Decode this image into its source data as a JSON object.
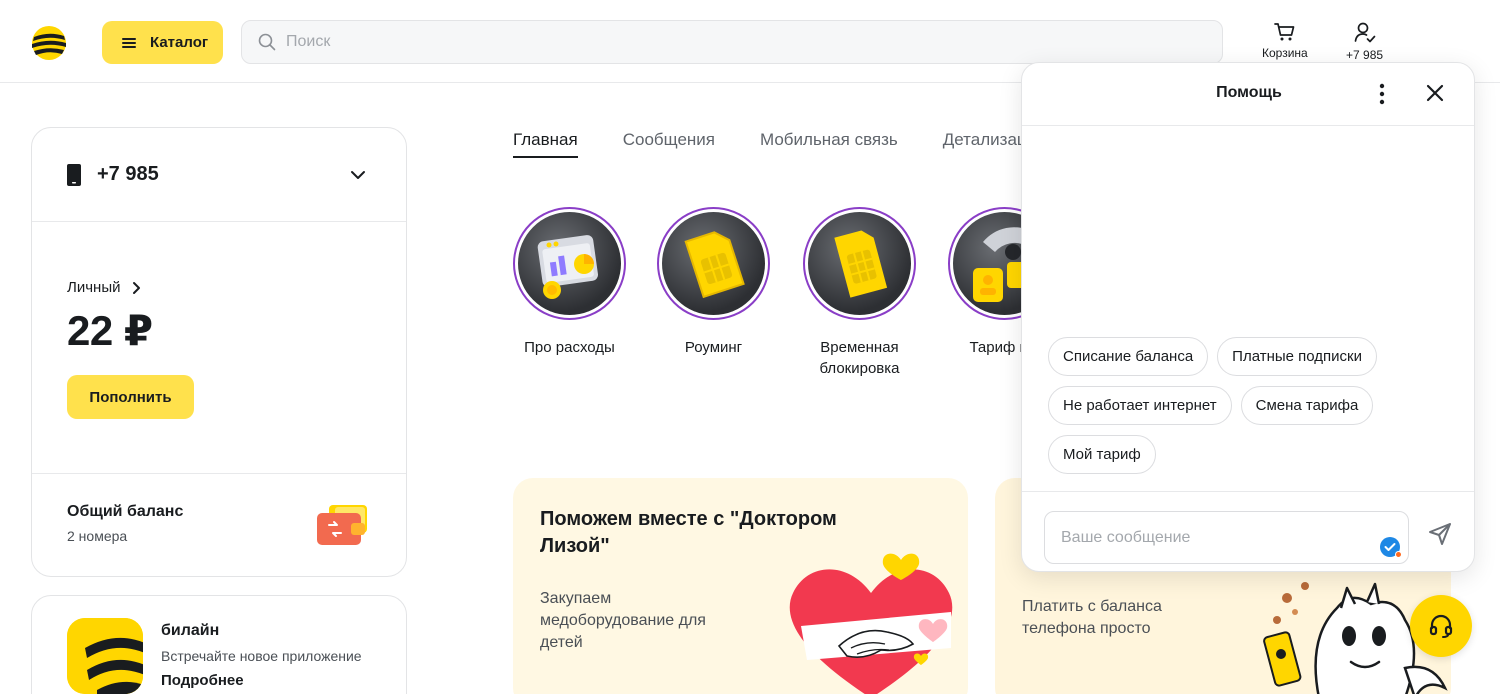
{
  "header": {
    "catalog_label": "Каталог",
    "search_placeholder": "Поиск",
    "cart_label": "Корзина",
    "profile_label": "+7 985"
  },
  "account": {
    "phone": "+7 985",
    "account_label": "Личный",
    "balance": "22 ₽",
    "topup_label": "Пополнить",
    "common_balance_title": "Общий баланс",
    "common_balance_sub": "2 номера"
  },
  "app_promo": {
    "title": "билайн",
    "subtitle": "Встречайте новое приложение",
    "link": "Подробнее"
  },
  "tabs": [
    {
      "label": "Главная",
      "active": true
    },
    {
      "label": "Сообщения"
    },
    {
      "label": "Мобильная связь"
    },
    {
      "label": "Детализация"
    }
  ],
  "stories": [
    {
      "label": "Про расходы",
      "icon": "expenses-icon"
    },
    {
      "label": "Роуминг",
      "icon": "sim-card-icon"
    },
    {
      "label": "Временная блокировка",
      "icon": "sim-card-icon"
    },
    {
      "label": "Тариф и у",
      "icon": "tariff-icon"
    }
  ],
  "promos": [
    {
      "title": "Поможем вместе с \"Доктором Лизой\"",
      "subtitle": "Закупаем медоборудование для детей"
    },
    {
      "subtitle": "Платить с баланса телефона просто"
    }
  ],
  "chat": {
    "title": "Помощь",
    "chips": [
      "Списание баланса",
      "Платные подписки",
      "Не работает интернет",
      "Смена тарифа",
      "Мой тариф"
    ],
    "input_placeholder": "Ваше сообщение"
  },
  "colors": {
    "accent": "#ffe14c",
    "brand_yellow": "#ffd600",
    "story_ring": "#8a3ec7",
    "text": "#191c1f"
  }
}
